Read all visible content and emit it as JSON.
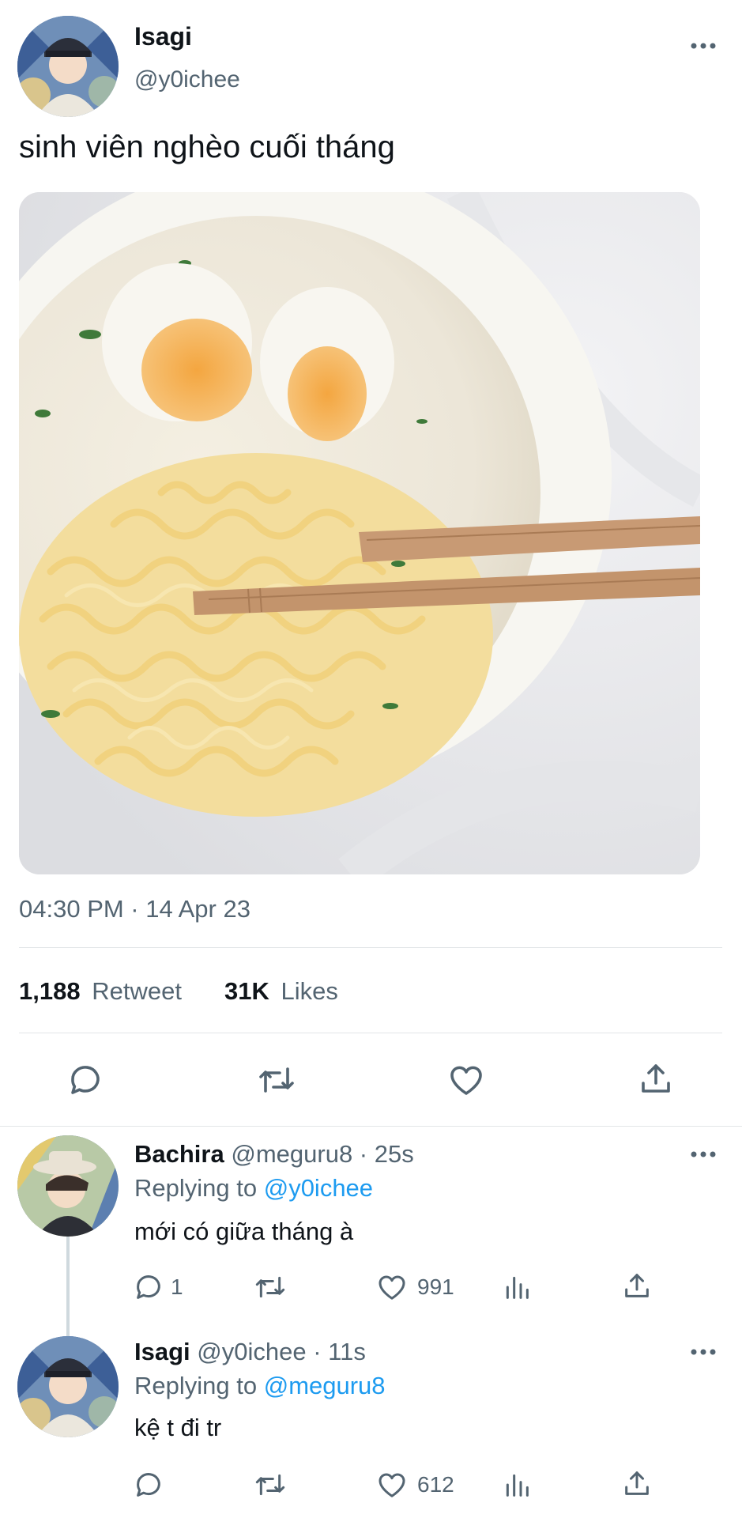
{
  "tweet": {
    "author_name": "Isagi",
    "author_handle": "@y0ichee",
    "text": "sinh viên nghèo cuối tháng",
    "timestamp": "04:30 PM · 14 Apr 23",
    "retweet_count": "1,188",
    "retweet_label": "Retweet",
    "likes_count": "31K",
    "likes_label": "Likes",
    "image_icon": "noodle-bowl-photo"
  },
  "actions": {
    "reply_icon": "reply-icon",
    "retweet_icon": "retweet-icon",
    "like_icon": "heart-icon",
    "share_icon": "share-icon",
    "more_icon": "more-icon"
  },
  "replies": [
    {
      "author_name": "Bachira",
      "author_handle": "@meguru8",
      "time": " · 25s",
      "replying_prefix": "Replying to",
      "replying_to": "@y0ichee",
      "text": "mới có giữa tháng à",
      "reply_count": "1",
      "retweet_count": "",
      "like_count": "991"
    },
    {
      "author_name": "Isagi",
      "author_handle": "@y0ichee",
      "time": " · 11s",
      "replying_prefix": "Replying to",
      "replying_to": "@meguru8",
      "text": "kệ t đi tr",
      "reply_count": "",
      "retweet_count": "",
      "like_count": "612"
    }
  ],
  "colors": {
    "text": "#0f1419",
    "muted": "#536471",
    "link": "#1d9bf0",
    "divider": "#e3e6e8"
  }
}
